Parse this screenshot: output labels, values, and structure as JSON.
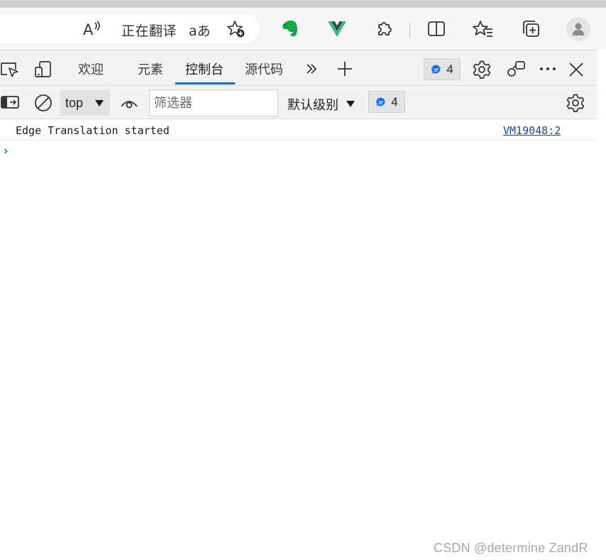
{
  "browser": {
    "translate_label": "正在翻译",
    "aa_label": "aあ",
    "icons": [
      "read-aloud-icon",
      "favorites-add-icon",
      "evernote-icon",
      "vue-devtools-icon",
      "extensions-icon",
      "split-screen-icon",
      "favorites-icon",
      "collections-icon",
      "profile-icon"
    ]
  },
  "devtools": {
    "tabs": [
      {
        "label": "欢迎"
      },
      {
        "label": "元素"
      },
      {
        "label": "控制台"
      },
      {
        "label": "源代码"
      }
    ],
    "issues_count": "4",
    "accent_color": "#0f6cbd"
  },
  "console_toolbar": {
    "context": "top",
    "filter_placeholder": "筛选器",
    "level": "默认级别",
    "message_count": "4"
  },
  "console": {
    "messages": [
      {
        "text": "Edge Translation started",
        "source": "VM19048:2"
      }
    ],
    "prompt": "›"
  },
  "watermark": "CSDN @determine  ZandR"
}
